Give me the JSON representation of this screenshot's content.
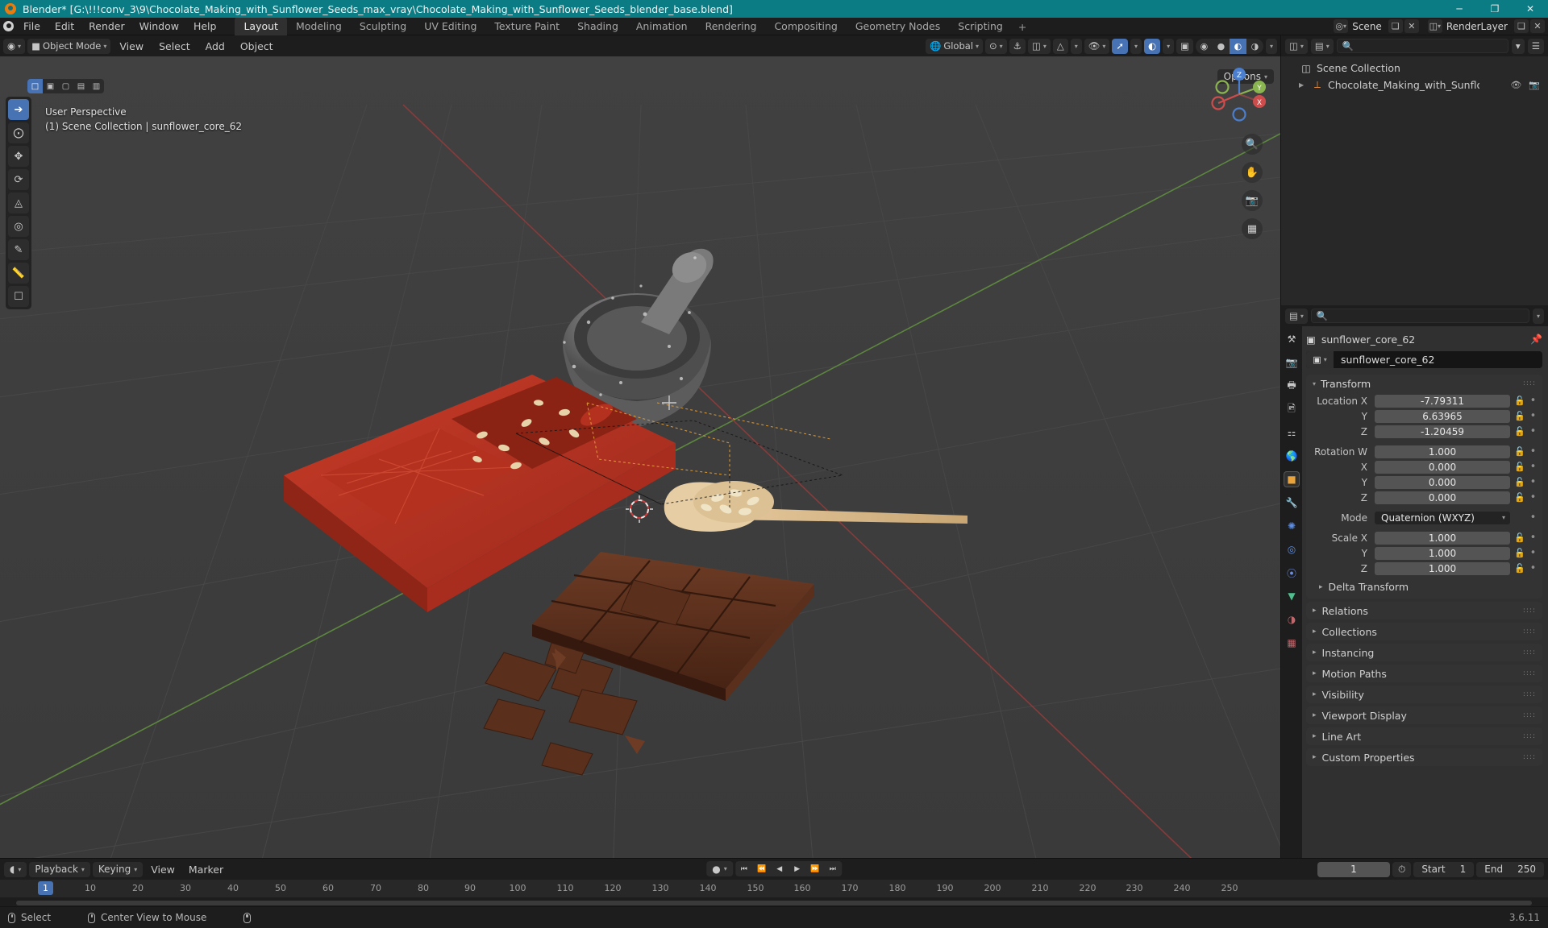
{
  "window": {
    "title": "Blender* [G:\\!!!conv_3\\9\\Chocolate_Making_with_Sunflower_Seeds_max_vray\\Chocolate_Making_with_Sunflower_Seeds_blender_base.blend]",
    "minimize": "─",
    "maximize": "❐",
    "close": "✕"
  },
  "topbar": {
    "menus": [
      "File",
      "Edit",
      "Render",
      "Window",
      "Help"
    ],
    "workspaces": [
      {
        "label": "Layout",
        "active": true
      },
      {
        "label": "Modeling",
        "active": false
      },
      {
        "label": "Sculpting",
        "active": false
      },
      {
        "label": "UV Editing",
        "active": false
      },
      {
        "label": "Texture Paint",
        "active": false
      },
      {
        "label": "Shading",
        "active": false
      },
      {
        "label": "Animation",
        "active": false
      },
      {
        "label": "Rendering",
        "active": false
      },
      {
        "label": "Compositing",
        "active": false
      },
      {
        "label": "Geometry Nodes",
        "active": false
      },
      {
        "label": "Scripting",
        "active": false
      }
    ],
    "add_workspace": "+",
    "scene_name": "Scene",
    "view_layer_name": "RenderLayer"
  },
  "viewport_header": {
    "editor_type_icon": "editor-3dview-icon",
    "mode": "Object Mode",
    "menus": [
      "View",
      "Select",
      "Add",
      "Object"
    ],
    "transform_orientation": "Global",
    "snap_label": "snap-magnet-icon",
    "proportional_label": "proportional-editing-icon",
    "options_label": "Options"
  },
  "viewport": {
    "perspective_label": "User Perspective",
    "collection_label": "(1) Scene Collection | sunflower_core_62",
    "gizmo_axes": [
      {
        "label": "X",
        "color": "#cd4c4c"
      },
      {
        "label": "Y",
        "color": "#8ab44f"
      },
      {
        "label": "Z",
        "color": "#4b7fcd"
      }
    ],
    "tools": [
      "tweak-select-tool",
      "cursor-tool",
      "move-tool",
      "rotate-tool",
      "scale-tool",
      "transform-tool",
      "annotate-tool",
      "measure-tool",
      "add-cube-tool"
    ],
    "select_modes": [
      "select-set",
      "select-extend",
      "select-subtract",
      "select-invert",
      "select-intersect"
    ],
    "nav_buttons": [
      "zoom-icon",
      "pan-hand-icon",
      "camera-view-icon",
      "toggle-ortho-icon"
    ]
  },
  "outliner": {
    "display_mode": "View Layer",
    "search_placeholder": "",
    "filter_icon": "filter-icon",
    "rows": [
      {
        "label": "Scene Collection",
        "icon": "collection-icon",
        "indent": 0,
        "expandable": false
      },
      {
        "label": "Chocolate_Making_with_Sunflower_See",
        "icon": "armature-icon",
        "indent": 1,
        "expandable": true,
        "eye": "◉",
        "camera": "▣"
      }
    ]
  },
  "properties": {
    "search_placeholder": "",
    "breadcrumb_object": "sunflower_core_62",
    "object_name": "sunflower_core_62",
    "tabs": [
      {
        "name": "tool-tab",
        "icon": "⚒",
        "active": false
      },
      {
        "name": "render-tab",
        "icon": "▣",
        "active": false
      },
      {
        "name": "output-tab",
        "icon": "⎙",
        "active": false
      },
      {
        "name": "view-layer-tab",
        "icon": "◫",
        "active": false
      },
      {
        "name": "scene-tab",
        "icon": "◔",
        "active": false
      },
      {
        "name": "world-tab",
        "icon": "♁",
        "active": false
      },
      {
        "name": "object-tab",
        "icon": "■",
        "active": true
      },
      {
        "name": "modifiers-tab",
        "icon": "ᵂ",
        "active": false
      },
      {
        "name": "particles-tab",
        "icon": "⁂",
        "active": false
      },
      {
        "name": "physics-tab",
        "icon": "◌",
        "active": false
      },
      {
        "name": "constraints-tab",
        "icon": "⚯",
        "active": false
      },
      {
        "name": "data-tab",
        "icon": "▽",
        "active": false
      },
      {
        "name": "material-tab",
        "icon": "◕",
        "active": false
      },
      {
        "name": "texture-tab",
        "icon": "▓",
        "active": false
      }
    ],
    "transform": {
      "title": "Transform",
      "fields": [
        {
          "label": "Location X",
          "value": "-7.79311"
        },
        {
          "label": "Y",
          "value": "6.63965"
        },
        {
          "label": "Z",
          "value": "-1.20459"
        },
        {
          "label": "Rotation W",
          "value": "1.000"
        },
        {
          "label": "X",
          "value": "0.000"
        },
        {
          "label": "Y",
          "value": "0.000"
        },
        {
          "label": "Z",
          "value": "0.000"
        }
      ],
      "mode_label": "Mode",
      "mode_value": "Quaternion (WXYZ)",
      "scale_fields": [
        {
          "label": "Scale X",
          "value": "1.000"
        },
        {
          "label": "Y",
          "value": "1.000"
        },
        {
          "label": "Z",
          "value": "1.000"
        }
      ],
      "delta_transform": "Delta Transform"
    },
    "panels": [
      "Relations",
      "Collections",
      "Instancing",
      "Motion Paths",
      "Visibility",
      "Viewport Display",
      "Line Art",
      "Custom Properties"
    ]
  },
  "timeline": {
    "editor_icon": "timeline-icon",
    "menus": [
      "Playback",
      "Keying",
      "View",
      "Marker"
    ],
    "auto_key_icon": "record-dot-icon",
    "transport": [
      "⏮",
      "⏪",
      "◀",
      "▶",
      "⏩",
      "⏭"
    ],
    "current_frame": "1",
    "start_label": "Start",
    "start_value": "1",
    "end_label": "End",
    "end_value": "250",
    "playhead_frame": "1",
    "ticks": [
      10,
      20,
      30,
      40,
      50,
      60,
      70,
      80,
      90,
      100,
      110,
      120,
      130,
      140,
      150,
      160,
      170,
      180,
      190,
      200,
      210,
      220,
      230,
      240,
      250
    ]
  },
  "statusbar": {
    "items": [
      {
        "icon": "mouse-left-icon",
        "label": "Select"
      },
      {
        "icon": "mouse-middle-icon",
        "label": "Center View to Mouse"
      },
      {
        "icon": "mouse-right-icon",
        "label": ""
      }
    ],
    "version": "3.6.11"
  },
  "colors": {
    "accent": "#4772b3",
    "title_bar": "#0b7b84",
    "panel_bg": "#303030",
    "editor_bg": "#1d1d1d"
  }
}
